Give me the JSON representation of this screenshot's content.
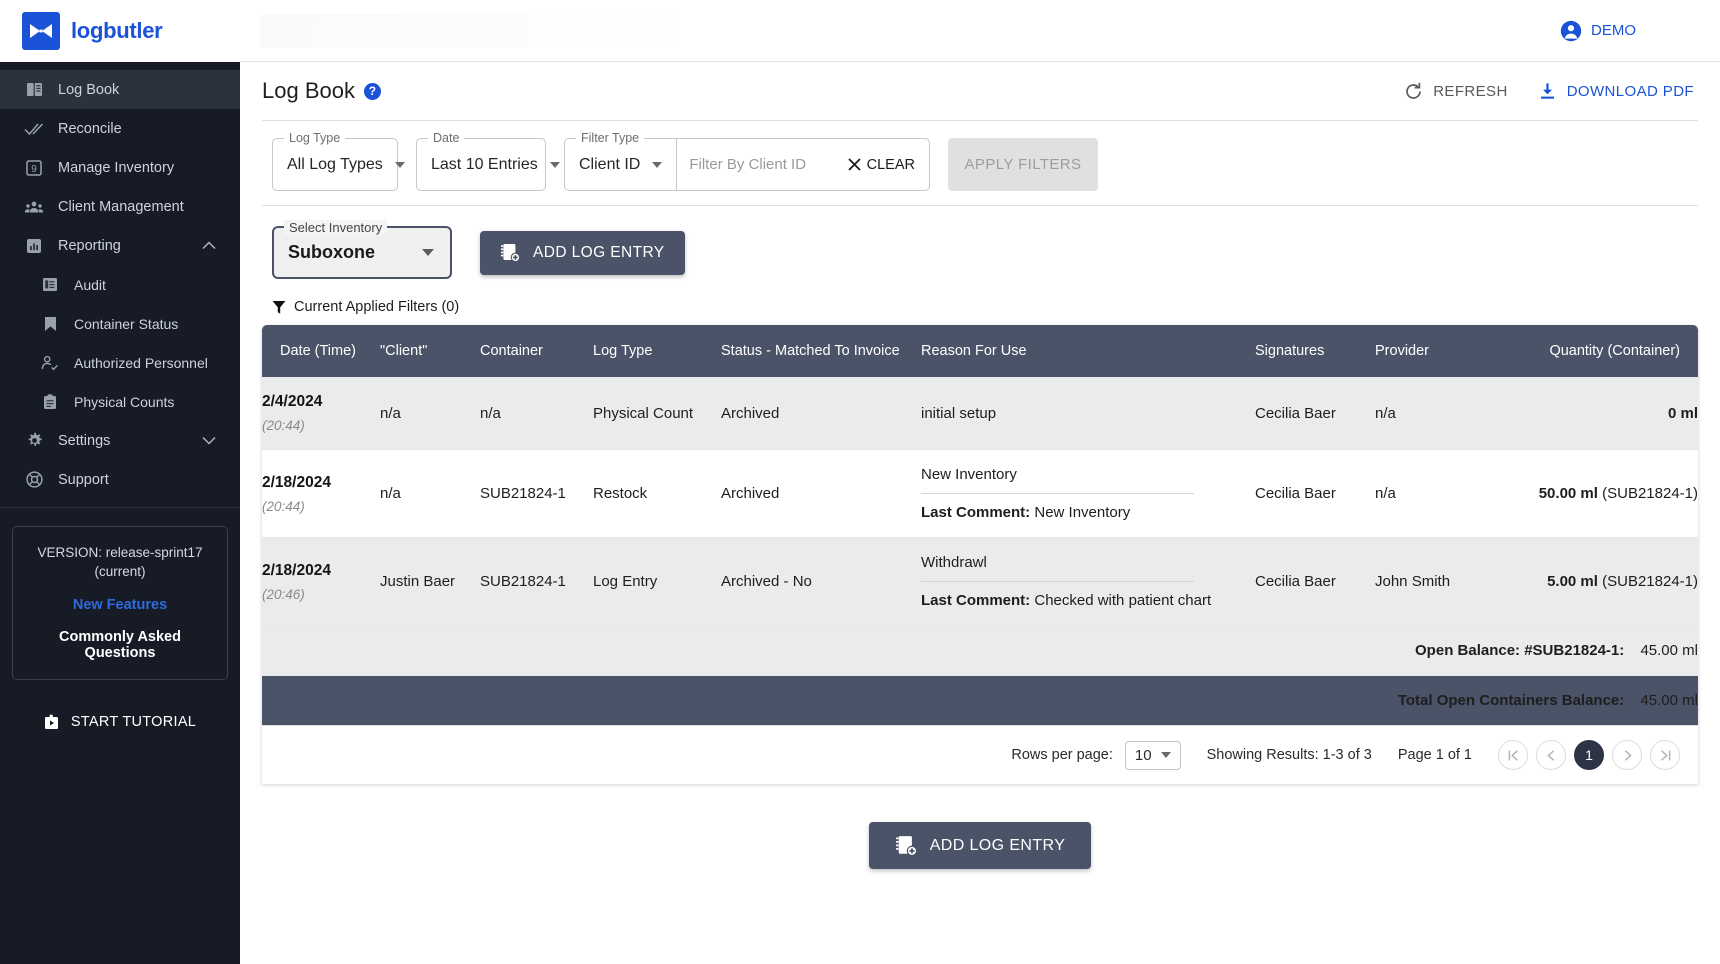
{
  "brand": {
    "name": "logbutler",
    "logo_icon": "bowtie-logo-icon",
    "accent": "#1a53d8"
  },
  "topbar": {
    "user_label": "DEMO",
    "user_icon": "account-circle-icon"
  },
  "sidebar": {
    "items": [
      {
        "label": "Log Book",
        "icon": "book-icon",
        "active": true
      },
      {
        "label": "Reconcile",
        "icon": "double-check-icon",
        "active": false
      },
      {
        "label": "Manage Inventory",
        "icon": "inventory-box-icon",
        "active": false
      },
      {
        "label": "Client Management",
        "icon": "people-group-icon",
        "active": false
      },
      {
        "label": "Reporting",
        "icon": "bar-chart-icon",
        "active": false,
        "expandable": true,
        "expanded": true
      }
    ],
    "reporting_children": [
      {
        "label": "Audit",
        "icon": "document-list-icon"
      },
      {
        "label": "Container Status",
        "icon": "bookmark-icon"
      },
      {
        "label": "Authorized Personnel",
        "icon": "person-check-icon"
      },
      {
        "label": "Physical Counts",
        "icon": "clipboard-icon"
      }
    ],
    "bottom_items": [
      {
        "label": "Settings",
        "icon": "gear-icon",
        "expandable": true,
        "expanded": false
      },
      {
        "label": "Support",
        "icon": "lifebuoy-icon"
      }
    ],
    "version_box": {
      "version_line1": "VERSION: release-sprint17",
      "version_line2": "(current)",
      "new_features": "New Features",
      "faq": "Commonly Asked Questions"
    },
    "start_tutorial": {
      "label": "START TUTORIAL",
      "icon": "tutorial-play-icon"
    }
  },
  "page": {
    "title": "Log Book",
    "help_badge": "?",
    "refresh": {
      "label": "REFRESH",
      "icon": "refresh-icon"
    },
    "download": {
      "label": "DOWNLOAD PDF",
      "icon": "download-icon"
    }
  },
  "filters": {
    "log_type": {
      "label": "Log Type",
      "value": "All Log Types"
    },
    "date": {
      "label": "Date",
      "value": "Last 10 Entries"
    },
    "filter_type": {
      "label": "Filter Type",
      "value": "Client ID"
    },
    "filter_input": {
      "placeholder": "Filter By Client ID",
      "value": ""
    },
    "clear": {
      "label": "CLEAR",
      "icon": "close-x-icon"
    },
    "apply": {
      "label": "APPLY FILTERS",
      "disabled": true
    },
    "applied_summary": {
      "label": "Current Applied Filters (0)",
      "icon": "funnel-filter-icon"
    }
  },
  "inventory": {
    "label": "Select Inventory",
    "value": "Suboxone",
    "add_entry": {
      "label": "ADD LOG ENTRY",
      "icon": "add-log-icon"
    }
  },
  "table": {
    "columns": [
      "Date (Time)",
      "\"Client\"",
      "Container",
      "Log Type",
      "Status - Matched To Invoice",
      "Reason For Use",
      "Signatures",
      "Provider",
      "Quantity (Container)"
    ],
    "rows": [
      {
        "date": "2/4/2024",
        "time": "(20:44)",
        "client": "n/a",
        "container": "n/a",
        "log_type": "Physical Count",
        "status": "Archived",
        "reason": "initial setup",
        "last_comment_label": "",
        "last_comment": "",
        "signatures": "Cecilia Baer",
        "provider": "n/a",
        "quantity": "0 ml",
        "quantity_container": ""
      },
      {
        "date": "2/18/2024",
        "time": "(20:44)",
        "client": "n/a",
        "container": "SUB21824-1",
        "log_type": "Restock",
        "status": "Archived",
        "reason": "New Inventory",
        "last_comment_label": "Last Comment:",
        "last_comment": "New Inventory",
        "signatures": "Cecilia Baer",
        "provider": "n/a",
        "quantity": "50.00 ml",
        "quantity_container": "(SUB21824-1)"
      },
      {
        "date": "2/18/2024",
        "time": "(20:46)",
        "client": "Justin Baer",
        "container": "SUB21824-1",
        "log_type": "Log Entry",
        "status": "Archived - No",
        "reason": "Withdrawl",
        "last_comment_label": "Last Comment:",
        "last_comment": "Checked with patient chart",
        "signatures": "Cecilia Baer",
        "provider": "John Smith",
        "quantity": "5.00 ml",
        "quantity_container": "(SUB21824-1)"
      }
    ],
    "open_balance": {
      "label": "Open Balance: #SUB21824-1:",
      "value": "45.00 ml"
    },
    "total_balance": {
      "label": "Total Open Containers Balance:",
      "value": "45.00 ml"
    }
  },
  "pager": {
    "rows_per_page_label": "Rows per page:",
    "rows_per_page_value": "10",
    "showing": "Showing Results: 1-3 of 3",
    "page_of": "Page 1 of 1",
    "first_icon": "first-page-icon",
    "prev_icon": "prev-page-icon",
    "current_page": "1",
    "next_icon": "next-page-icon",
    "last_icon": "last-page-icon"
  },
  "bottom_cta": {
    "label": "ADD LOG ENTRY",
    "icon": "add-log-icon"
  }
}
